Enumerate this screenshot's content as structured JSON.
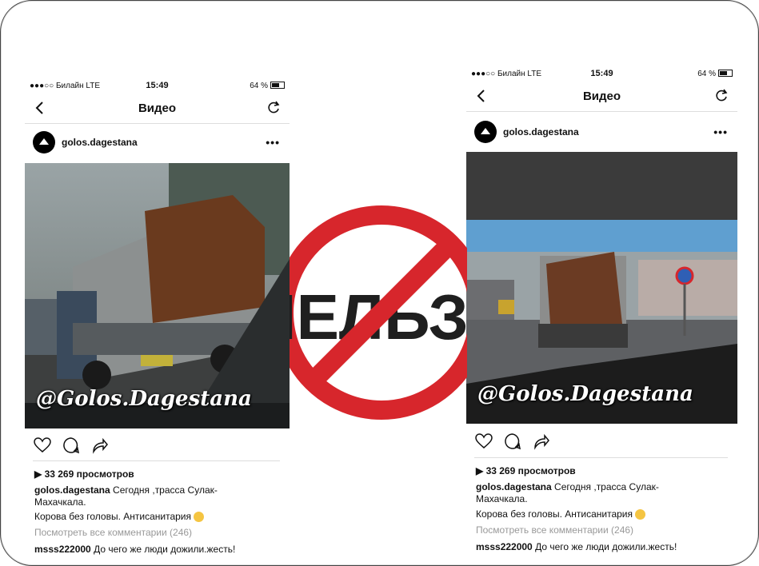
{
  "left": {
    "status": {
      "carrier": "●●●○○ Билайн  LTE",
      "time": "15:49",
      "battery": "64 %"
    },
    "nav_title": "Видео",
    "username": "golos.dagestana",
    "watermark": "@Golos.Dagestana",
    "views": "33 269 просмотров",
    "caption_user": "golos.dagestana",
    "caption_text": "Сегодня ,трасса Сулак-Махачкала.",
    "caption_line2": "Корова без головы. Антисанитария",
    "comments_link": "Посмотреть все комментарии (246)",
    "comment_user": "msss222000",
    "comment_text": "До чего же люди дожили.жесть!"
  },
  "right": {
    "status": {
      "carrier": "●●●○○ Билайн  LTE",
      "time": "15:49",
      "battery": "64 %"
    },
    "nav_title": "Видео",
    "username": "golos.dagestana",
    "watermark": "@Golos.Dagestana",
    "views": "33 269 просмотров",
    "caption_user": "golos.dagestana",
    "caption_text": "Сегодня ,трасса Сулак-Махачкала.",
    "caption_line2": "Корова без головы. Антисанитария",
    "comments_link": "Посмотреть все комментарии (246)",
    "comment_user": "msss222000",
    "comment_text": "До чего же люди дожили.жесть!"
  },
  "overlay_text": "НЕЛЬЗЯ",
  "colors": {
    "prohibition_red": "#d7262c",
    "text": "#111111",
    "muted": "#999999"
  },
  "icons": [
    "back-icon",
    "refresh-icon",
    "more-icon",
    "heart-icon",
    "comment-icon",
    "share-icon",
    "emoji-icon"
  ]
}
